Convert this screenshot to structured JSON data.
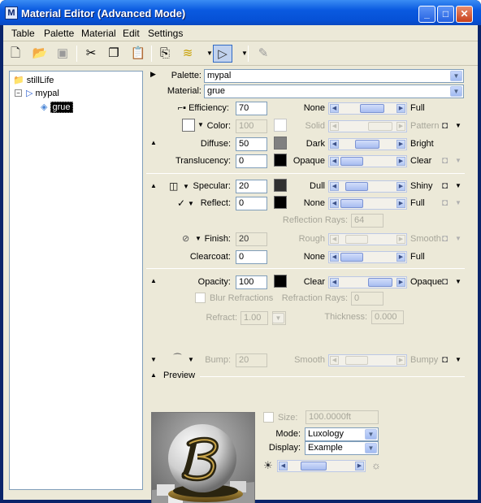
{
  "window": {
    "title": "Material Editor (Advanced Mode)",
    "app_icon_letter": "M"
  },
  "menu": [
    "Table",
    "Palette",
    "Material",
    "Edit",
    "Settings"
  ],
  "toolbar": [
    "new-icon",
    "open-icon",
    "save-icon",
    "cut-icon",
    "copy-icon",
    "paste-icon",
    "assign-icon",
    "layers-icon",
    "pointer-icon",
    "apply-icon"
  ],
  "tree": {
    "root": "stillLife",
    "palette": "mypal",
    "material": "grue"
  },
  "palette": {
    "label": "Palette:",
    "value": "mypal"
  },
  "material": {
    "label": "Material:",
    "value": "grue"
  },
  "rows": {
    "efficiency": {
      "label": "Efficiency:",
      "value": "70",
      "left": "None",
      "right": "Full"
    },
    "color": {
      "label": "Color:",
      "value": "100",
      "left": "Solid",
      "right": "Pattern"
    },
    "diffuse": {
      "label": "Diffuse:",
      "value": "50",
      "left": "Dark",
      "right": "Bright"
    },
    "translucency": {
      "label": "Translucency:",
      "value": "0",
      "left": "Opaque",
      "right": "Clear"
    },
    "specular": {
      "label": "Specular:",
      "value": "20",
      "left": "Dull",
      "right": "Shiny"
    },
    "reflect": {
      "label": "Reflect:",
      "value": "0",
      "left": "None",
      "right": "Full"
    },
    "reflection_rays": {
      "label": "Reflection Rays:",
      "value": "64"
    },
    "finish": {
      "label": "Finish:",
      "value": "20",
      "left": "Rough",
      "right": "Smooth"
    },
    "clearcoat": {
      "label": "Clearcoat:",
      "value": "0",
      "left": "None",
      "right": "Full"
    },
    "opacity": {
      "label": "Opacity:",
      "value": "100",
      "left": "Clear",
      "right": "Opaque"
    },
    "blur_refractions": {
      "label": "Blur Refractions"
    },
    "refraction_rays": {
      "label": "Refraction Rays:",
      "value": "0"
    },
    "refract": {
      "label": "Refract:",
      "value": "1.00"
    },
    "thickness": {
      "label": "Thickness:",
      "value": "0.000"
    },
    "bump": {
      "label": "Bump:",
      "value": "20",
      "left": "Smooth",
      "right": "Bumpy"
    }
  },
  "preview": {
    "label": "Preview",
    "size_label": "Size:",
    "size_value": "100.0000ft",
    "mode_label": "Mode:",
    "mode_value": "Luxology",
    "display_label": "Display:",
    "display_value": "Example",
    "brightness_level_percent": 30
  },
  "colors": {
    "accent": "#0a246a",
    "swatch_diffuse": "#808080",
    "swatch_translucency": "#000000",
    "swatch_specular": "#303030",
    "swatch_reflect": "#000000",
    "swatch_opacity": "#000000"
  }
}
